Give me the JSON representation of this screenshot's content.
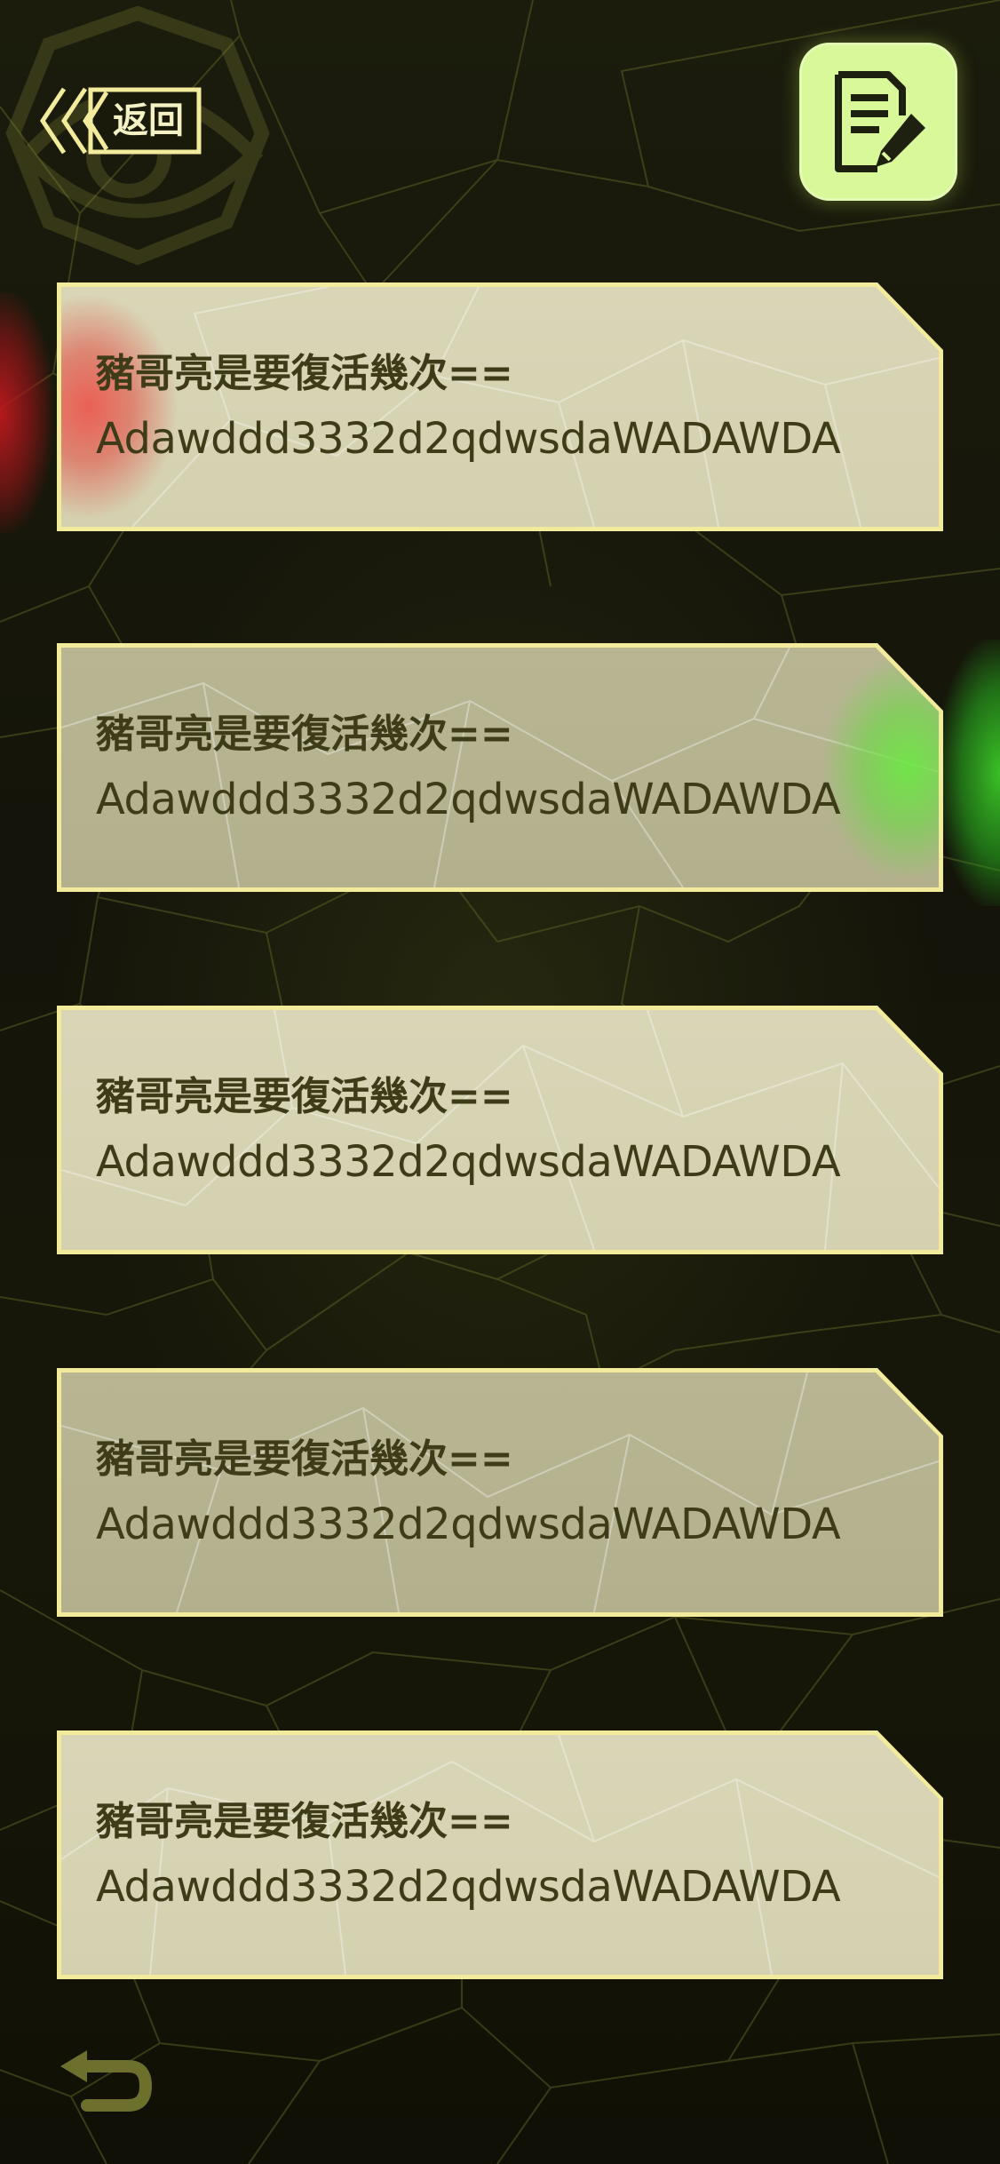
{
  "header": {
    "back_label": "返回",
    "back_icon": "double-chevron-left-icon",
    "notes_icon": "note-edit-icon"
  },
  "colors": {
    "background": "#161609",
    "card_border": "#f1eb9b",
    "card_light": "#d9d6b7",
    "card_dark": "#b8b593",
    "text": "#3e3b18",
    "notes_button": "#d9f89a",
    "accent_red": "#e0504a",
    "accent_green": "#6ee046"
  },
  "cards": [
    {
      "title": "豬哥亮是要復活幾次==",
      "code": "Adawddd3332d2qdwsdaWADAWDA",
      "tone": "light",
      "indicator": "red"
    },
    {
      "title": "豬哥亮是要復活幾次==",
      "code": "Adawddd3332d2qdwsdaWADAWDA",
      "tone": "dark",
      "indicator": "green"
    },
    {
      "title": "豬哥亮是要復活幾次==",
      "code": "Adawddd3332d2qdwsdaWADAWDA",
      "tone": "light",
      "indicator": "none"
    },
    {
      "title": "豬哥亮是要復活幾次==",
      "code": "Adawddd3332d2qdwsdaWADAWDA",
      "tone": "dark",
      "indicator": "none"
    },
    {
      "title": "豬哥亮是要復活幾次==",
      "code": "Adawddd3332d2qdwsdaWADAWDA",
      "tone": "light",
      "indicator": "none"
    }
  ],
  "footer": {
    "undo_icon": "undo-arrow-icon"
  }
}
